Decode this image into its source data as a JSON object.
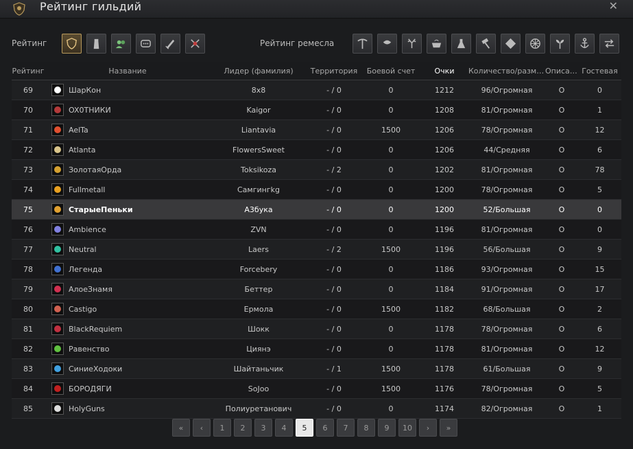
{
  "window": {
    "title": "Рейтинг гильдий",
    "close_glyph": "✕"
  },
  "toolbar": {
    "rating_label": "Рейтинг",
    "craft_label": "Рейтинг ремесла",
    "rating_categories": [
      "shield-crest-icon",
      "tower-icon",
      "people-icon",
      "chat-bubble-icon",
      "sword-icon",
      "crossed-flags-icon"
    ],
    "craft_categories": [
      "pickaxe-icon",
      "fishing-icon",
      "antlers-icon",
      "cooking-pot-icon",
      "alchemy-flask-icon",
      "hammer-icon",
      "arrow-shield-icon",
      "wheel-icon",
      "sprout-icon",
      "anchor-icon",
      "trade-arrows-icon"
    ]
  },
  "table": {
    "headers": {
      "rank": "Рейтинг",
      "name": "Название",
      "leader": "Лидер (фамилия)",
      "territory": "Территория",
      "battle": "Боевой счет",
      "points": "Очки",
      "count": "Количество/размер",
      "desc": "Описание",
      "guest": "Гостевая"
    },
    "rows": [
      {
        "rank": "69",
        "name": "ШарКон",
        "leader": "8x8",
        "territory": "- / 0",
        "battle": "0",
        "points": "1212",
        "count": "96/Огромная",
        "desc": "O",
        "guest": "0",
        "color": "#ffffff"
      },
      {
        "rank": "70",
        "name": "OX0TНИКИ",
        "leader": "Kaigor",
        "territory": "- / 0",
        "battle": "0",
        "points": "1208",
        "count": "81/Огромная",
        "desc": "O",
        "guest": "1",
        "color": "#b33a3a"
      },
      {
        "rank": "71",
        "name": "AelTa",
        "leader": "Liantavia",
        "territory": "- / 0",
        "battle": "1500",
        "points": "1206",
        "count": "78/Огромная",
        "desc": "O",
        "guest": "12",
        "color": "#e05030"
      },
      {
        "rank": "72",
        "name": "Atlanta",
        "leader": "FlowersSweet",
        "territory": "- / 0",
        "battle": "0",
        "points": "1206",
        "count": "44/Средняя",
        "desc": "O",
        "guest": "6",
        "color": "#d9c48a"
      },
      {
        "rank": "73",
        "name": "ЗолотаяОрда",
        "leader": "Toksikoza",
        "territory": "- / 2",
        "battle": "0",
        "points": "1202",
        "count": "81/Огромная",
        "desc": "O",
        "guest": "78",
        "color": "#d4a030"
      },
      {
        "rank": "74",
        "name": "Fullmetall",
        "leader": "Самгингkg",
        "territory": "- / 0",
        "battle": "0",
        "points": "1200",
        "count": "78/Огромная",
        "desc": "O",
        "guest": "5",
        "color": "#e8a020"
      },
      {
        "rank": "75",
        "name": "СтарыеПеньки",
        "leader": "А3бука",
        "territory": "- / 0",
        "battle": "0",
        "points": "1200",
        "count": "52/Большая",
        "desc": "O",
        "guest": "0",
        "color": "#e0a030"
      },
      {
        "rank": "76",
        "name": "Ambience",
        "leader": "ZVN",
        "territory": "- / 0",
        "battle": "0",
        "points": "1196",
        "count": "81/Огромная",
        "desc": "O",
        "guest": "0",
        "color": "#8080e0"
      },
      {
        "rank": "77",
        "name": "Neutral",
        "leader": "Laers",
        "territory": "- / 2",
        "battle": "1500",
        "points": "1196",
        "count": "56/Большая",
        "desc": "O",
        "guest": "9",
        "color": "#30c0a0"
      },
      {
        "rank": "78",
        "name": "Легенда",
        "leader": "Forcebery",
        "territory": "- / 0",
        "battle": "0",
        "points": "1186",
        "count": "93/Огромная",
        "desc": "O",
        "guest": "15",
        "color": "#4070d0"
      },
      {
        "rank": "79",
        "name": "АлоеЗнамя",
        "leader": "Беттер",
        "territory": "- / 0",
        "battle": "0",
        "points": "1184",
        "count": "91/Огромная",
        "desc": "O",
        "guest": "17",
        "color": "#d03050"
      },
      {
        "rank": "80",
        "name": "Castigo",
        "leader": "Ермола",
        "territory": "- / 0",
        "battle": "1500",
        "points": "1182",
        "count": "68/Большая",
        "desc": "O",
        "guest": "2",
        "color": "#d06050"
      },
      {
        "rank": "81",
        "name": "BlackRequiem",
        "leader": "Шокк",
        "territory": "- / 0",
        "battle": "0",
        "points": "1178",
        "count": "78/Огромная",
        "desc": "O",
        "guest": "6",
        "color": "#c03040"
      },
      {
        "rank": "82",
        "name": "Равенство",
        "leader": "Циянэ",
        "territory": "- / 0",
        "battle": "0",
        "points": "1178",
        "count": "81/Огромная",
        "desc": "O",
        "guest": "12",
        "color": "#60c040"
      },
      {
        "rank": "83",
        "name": "СиниеХодоки",
        "leader": "Шайтаньчик",
        "territory": "- / 1",
        "battle": "1500",
        "points": "1178",
        "count": "61/Большая",
        "desc": "O",
        "guest": "9",
        "color": "#40a0e0"
      },
      {
        "rank": "84",
        "name": "БОРОДЯГИ",
        "leader": "SoJoo",
        "territory": "- / 0",
        "battle": "1500",
        "points": "1176",
        "count": "78/Огромная",
        "desc": "O",
        "guest": "5",
        "color": "#c02020"
      },
      {
        "rank": "85",
        "name": "HolyGuns",
        "leader": "Полиуретанович",
        "territory": "- / 0",
        "battle": "0",
        "points": "1174",
        "count": "82/Огромная",
        "desc": "O",
        "guest": "1",
        "color": "#dddddd"
      }
    ],
    "highlight_rank": "75"
  },
  "pager": {
    "first": "«",
    "prev": "‹",
    "pages": [
      "1",
      "2",
      "3",
      "4",
      "5",
      "6",
      "7",
      "8",
      "9",
      "10"
    ],
    "current": "5",
    "next": "›",
    "last": "»"
  }
}
